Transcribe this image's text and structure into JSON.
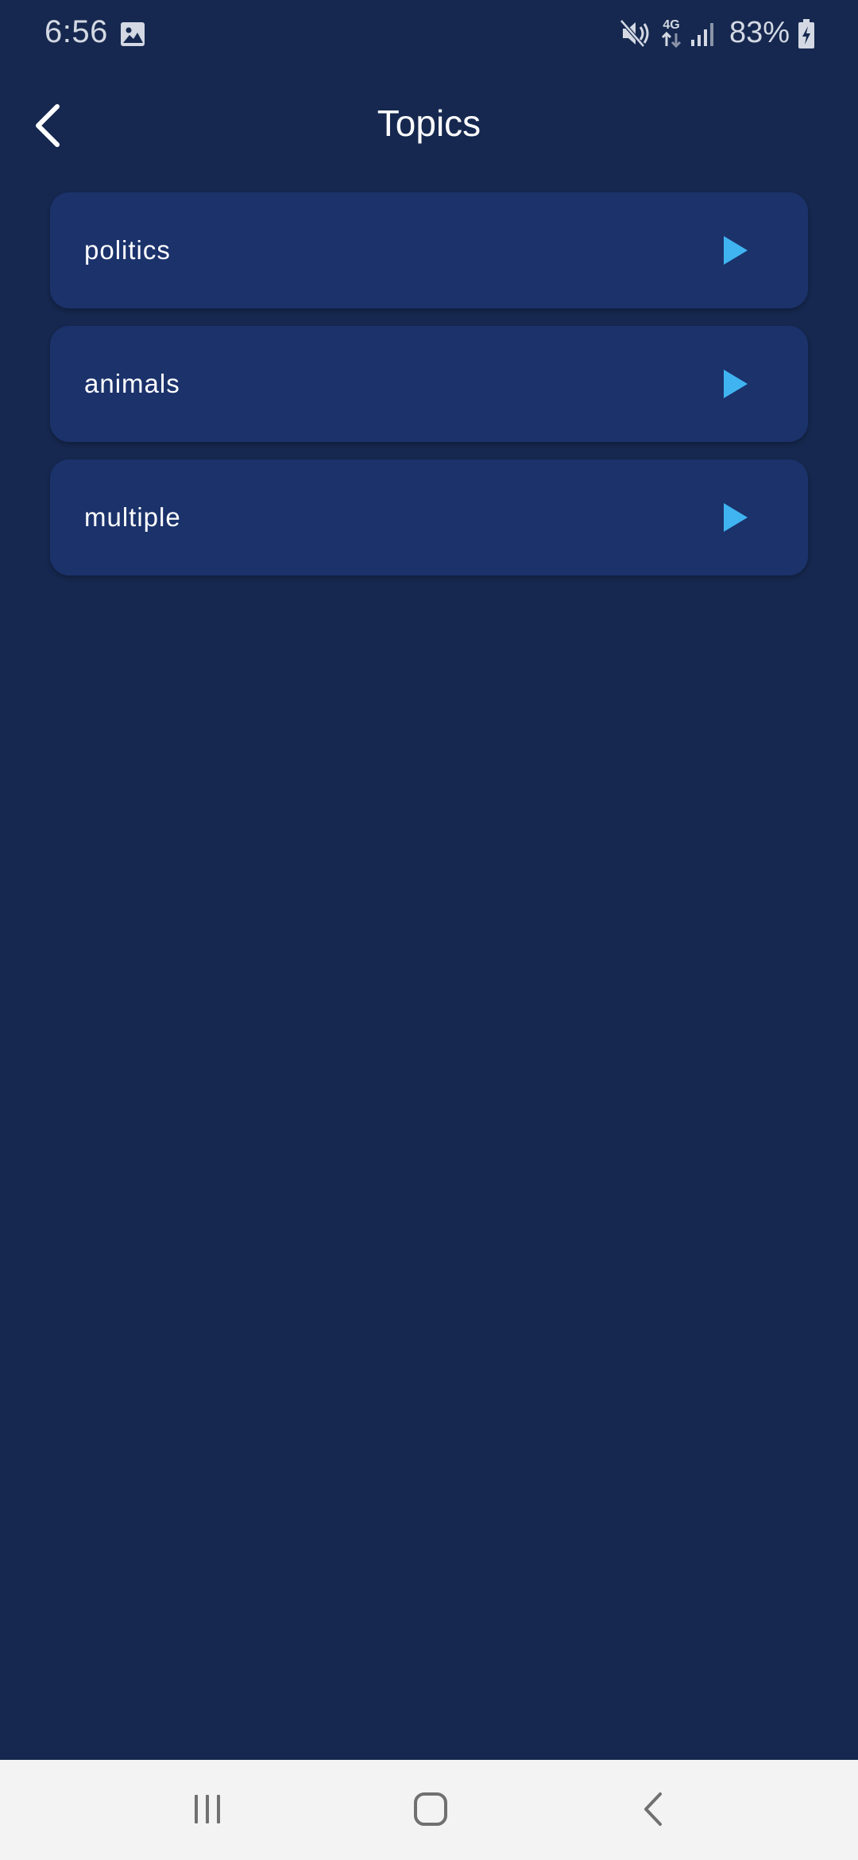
{
  "status_bar": {
    "time": "6:56",
    "battery": "83%",
    "network": "4G",
    "icons": [
      "image-icon",
      "mute-icon",
      "network-4g-icon",
      "signal-icon",
      "battery-charging-icon"
    ]
  },
  "header": {
    "title": "Topics",
    "back_icon": "chevron-left-icon"
  },
  "topics": [
    {
      "label": "politics",
      "icon": "play-icon"
    },
    {
      "label": "animals",
      "icon": "play-icon"
    },
    {
      "label": "multiple",
      "icon": "play-icon"
    }
  ],
  "nav_bar": {
    "buttons": [
      "recent-apps-icon",
      "home-icon",
      "back-icon"
    ]
  },
  "colors": {
    "background": "#16284f",
    "card": "#1b326b",
    "accent": "#40b4f0",
    "nav_bar": "#f3f3f3"
  }
}
